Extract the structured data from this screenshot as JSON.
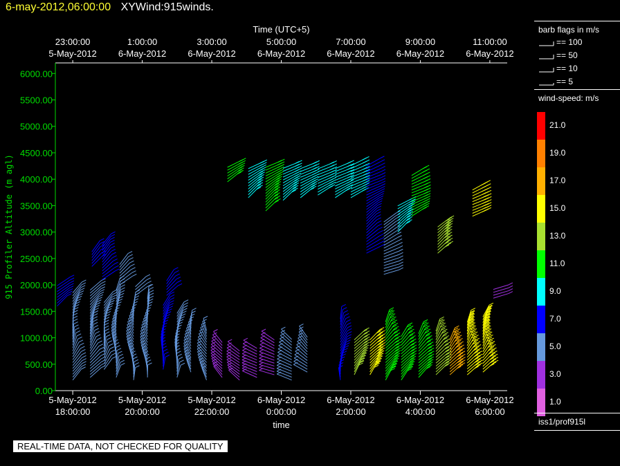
{
  "header": {
    "date_time": "6-may-2012,06:00:00",
    "product": "XYWind:915winds."
  },
  "notice": "REAL-TIME DATA, NOT CHECKED FOR QUALITY",
  "source_label": "iss1/prof915l",
  "legend": {
    "barb_title": "barb flags in m/s",
    "barbs": [
      {
        "label": "== 100",
        "kind": "pennant2"
      },
      {
        "label": "== 50",
        "kind": "pennant"
      },
      {
        "label": "== 10",
        "kind": "full"
      },
      {
        "label": "== 5",
        "kind": "half"
      }
    ],
    "speed_title": "wind-speed: m/s",
    "speed_bins": [
      {
        "label": "21.0",
        "color": "#ff0000"
      },
      {
        "label": "19.0",
        "color": "#ff8000"
      },
      {
        "label": "17.0",
        "color": "#ffb000"
      },
      {
        "label": "15.0",
        "color": "#ffff00"
      },
      {
        "label": "13.0",
        "color": "#a8e030"
      },
      {
        "label": "11.0",
        "color": "#00ff00"
      },
      {
        "label": "9.0",
        "color": "#00ffff"
      },
      {
        "label": "7.0",
        "color": "#0000ff"
      },
      {
        "label": "5.0",
        "color": "#6699dd"
      },
      {
        "label": "3.0",
        "color": "#a030e0"
      },
      {
        "label": "1.0",
        "color": "#e060e0"
      }
    ]
  },
  "chart_data": {
    "type": "wind-barb time-height",
    "ylabel": "915 Profiler Altitude (m agl)",
    "xlabel": "time",
    "top_axis_title": "Time (UTC+5)",
    "ylim": [
      0,
      6200
    ],
    "y_ticks": [
      "0.00",
      "500.00",
      "1000.00",
      "1500.00",
      "2000.00",
      "2500.00",
      "3000.00",
      "3500.00",
      "4000.00",
      "4500.00",
      "5000.00",
      "5500.00",
      "6000.00"
    ],
    "y_tick_values": [
      0,
      500,
      1000,
      1500,
      2000,
      2500,
      3000,
      3500,
      4000,
      4500,
      5000,
      5500,
      6000
    ],
    "x_range_hours": [
      17.5,
      30.5
    ],
    "x_ticks_bottom": [
      {
        "hour": 18,
        "date": "5-May-2012",
        "time": "18:00:00"
      },
      {
        "hour": 20,
        "date": "5-May-2012",
        "time": "20:00:00"
      },
      {
        "hour": 22,
        "date": "5-May-2012",
        "time": "22:00:00"
      },
      {
        "hour": 24,
        "date": "6-May-2012",
        "time": "0:00:00"
      },
      {
        "hour": 26,
        "date": "6-May-2012",
        "time": "2:00:00"
      },
      {
        "hour": 28,
        "date": "6-May-2012",
        "time": "4:00:00"
      },
      {
        "hour": 30,
        "date": "6-May-2012",
        "time": "6:00:00"
      }
    ],
    "x_ticks_top": [
      {
        "hour": 18,
        "time": "23:00:00",
        "date": "5-May-2012"
      },
      {
        "hour": 20,
        "time": "1:00:00",
        "date": "6-May-2012"
      },
      {
        "hour": 22,
        "time": "3:00:00",
        "date": "6-May-2012"
      },
      {
        "hour": 24,
        "time": "5:00:00",
        "date": "6-May-2012"
      },
      {
        "hour": 26,
        "time": "7:00:00",
        "date": "6-May-2012"
      },
      {
        "hour": 28,
        "time": "9:00:00",
        "date": "6-May-2012"
      },
      {
        "hour": 30,
        "time": "11:00:00",
        "date": "6-May-2012"
      }
    ],
    "profiles": [
      {
        "hour": 17.55,
        "bottom": 1600,
        "top": 2000,
        "speed": 6,
        "dir": 220
      },
      {
        "hour": 18.0,
        "bottom": 200,
        "top": 1900,
        "speed": 4,
        "dir": 200
      },
      {
        "hour": 18.5,
        "bottom": 250,
        "top": 1900,
        "speed": 5,
        "dir": 210
      },
      {
        "hour": 18.55,
        "bottom": 2350,
        "top": 2650,
        "speed": 6,
        "dir": 230
      },
      {
        "hour": 18.85,
        "bottom": 2100,
        "top": 2800,
        "speed": 7,
        "dir": 230
      },
      {
        "hour": 18.9,
        "bottom": 400,
        "top": 1700,
        "speed": 5,
        "dir": 200
      },
      {
        "hour": 19.25,
        "bottom": 250,
        "top": 1900,
        "speed": 4,
        "dir": 180
      },
      {
        "hour": 19.35,
        "bottom": 2000,
        "top": 2400,
        "speed": 5,
        "dir": 230
      },
      {
        "hour": 19.75,
        "bottom": 200,
        "top": 1650,
        "speed": 4,
        "dir": 170
      },
      {
        "hour": 19.8,
        "bottom": 1800,
        "top": 2000,
        "speed": 5,
        "dir": 220
      },
      {
        "hour": 20.15,
        "bottom": 250,
        "top": 1750,
        "speed": 4,
        "dir": 170
      },
      {
        "hour": 20.6,
        "bottom": 400,
        "top": 1650,
        "speed": 6,
        "dir": 190
      },
      {
        "hour": 20.7,
        "bottom": 1800,
        "top": 2100,
        "speed": 6,
        "dir": 220
      },
      {
        "hour": 21.0,
        "bottom": 250,
        "top": 1500,
        "speed": 5,
        "dir": 190
      },
      {
        "hour": 21.4,
        "bottom": 350,
        "top": 1300,
        "speed": 5,
        "dir": 170
      },
      {
        "hour": 21.85,
        "bottom": 200,
        "top": 1150,
        "speed": 4,
        "dir": 160
      },
      {
        "hour": 22.3,
        "bottom": 250,
        "top": 950,
        "speed": 3,
        "dir": 150
      },
      {
        "hour": 22.45,
        "bottom": 3950,
        "top": 4250,
        "speed": 10,
        "dir": 240
      },
      {
        "hour": 22.8,
        "bottom": 200,
        "top": 800,
        "speed": 3,
        "dir": 140
      },
      {
        "hour": 23.05,
        "bottom": 3650,
        "top": 4250,
        "speed": 8,
        "dir": 240
      },
      {
        "hour": 23.3,
        "bottom": 250,
        "top": 850,
        "speed": 3,
        "dir": 120
      },
      {
        "hour": 23.55,
        "bottom": 3400,
        "top": 4250,
        "speed": 11,
        "dir": 240
      },
      {
        "hour": 23.8,
        "bottom": 300,
        "top": 1000,
        "speed": 3,
        "dir": 110
      },
      {
        "hour": 24.05,
        "bottom": 3600,
        "top": 4250,
        "speed": 8,
        "dir": 240
      },
      {
        "hour": 24.3,
        "bottom": 200,
        "top": 1000,
        "speed": 4,
        "dir": 120
      },
      {
        "hour": 24.55,
        "bottom": 3650,
        "top": 4200,
        "speed": 8,
        "dir": 240
      },
      {
        "hour": 24.75,
        "bottom": 350,
        "top": 1050,
        "speed": 4,
        "dir": 130
      },
      {
        "hour": 25.05,
        "bottom": 3700,
        "top": 4200,
        "speed": 8,
        "dir": 240
      },
      {
        "hour": 25.55,
        "bottom": 3650,
        "top": 4250,
        "speed": 8,
        "dir": 240
      },
      {
        "hour": 25.7,
        "bottom": 200,
        "top": 1400,
        "speed": 7,
        "dir": 190
      },
      {
        "hour": 26.0,
        "bottom": 3650,
        "top": 4300,
        "speed": 8,
        "dir": 240
      },
      {
        "hour": 26.1,
        "bottom": 300,
        "top": 1000,
        "speed": 12,
        "dir": 210
      },
      {
        "hour": 26.45,
        "bottom": 2600,
        "top": 4300,
        "speed": 7,
        "dir": 240
      },
      {
        "hour": 26.55,
        "bottom": 300,
        "top": 1000,
        "speed": 14,
        "dir": 210
      },
      {
        "hour": 26.95,
        "bottom": 2200,
        "top": 3200,
        "speed": 4,
        "dir": 250
      },
      {
        "hour": 27.0,
        "bottom": 200,
        "top": 1300,
        "speed": 10,
        "dir": 210
      },
      {
        "hour": 27.35,
        "bottom": 3000,
        "top": 3500,
        "speed": 9,
        "dir": 240
      },
      {
        "hour": 27.45,
        "bottom": 200,
        "top": 1050,
        "speed": 10,
        "dir": 210
      },
      {
        "hour": 27.75,
        "bottom": 3300,
        "top": 4100,
        "speed": 11,
        "dir": 240
      },
      {
        "hour": 27.95,
        "bottom": 250,
        "top": 1100,
        "speed": 11,
        "dir": 210
      },
      {
        "hour": 28.45,
        "bottom": 300,
        "top": 1150,
        "speed": 12,
        "dir": 210
      },
      {
        "hour": 28.5,
        "bottom": 2600,
        "top": 3100,
        "speed": 13,
        "dir": 240
      },
      {
        "hour": 28.85,
        "bottom": 300,
        "top": 1000,
        "speed": 16,
        "dir": 210
      },
      {
        "hour": 29.35,
        "bottom": 300,
        "top": 1300,
        "speed": 15,
        "dir": 210
      },
      {
        "hour": 29.5,
        "bottom": 3300,
        "top": 3800,
        "speed": 15,
        "dir": 240
      },
      {
        "hour": 29.8,
        "bottom": 350,
        "top": 1400,
        "speed": 14,
        "dir": 210
      },
      {
        "hour": 30.1,
        "bottom": 1750,
        "top": 1950,
        "speed": 3,
        "dir": 250
      }
    ]
  }
}
